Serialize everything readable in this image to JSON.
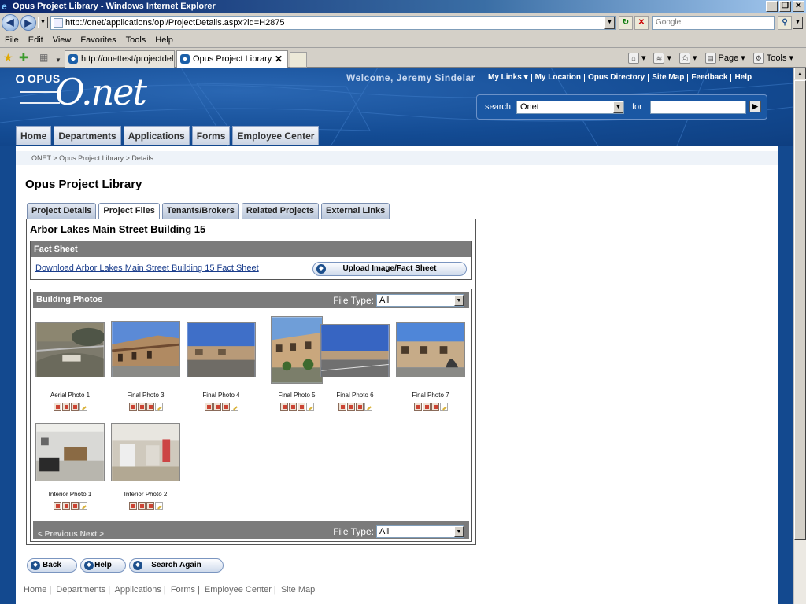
{
  "window": {
    "title": "Opus Project Library - Windows Internet Explorer"
  },
  "browser": {
    "url": "http://onet/applications/opl/ProjectDetails.aspx?id=H2875",
    "search_placeholder": "Google",
    "menu": [
      "File",
      "Edit",
      "View",
      "Favorites",
      "Tools",
      "Help"
    ],
    "tabs": [
      {
        "label": "http://onettest/projectdeliv..."
      },
      {
        "label": "Opus Project Library"
      }
    ],
    "commands": {
      "page": "Page",
      "tools": "Tools"
    }
  },
  "site": {
    "logo_small": "OPUS",
    "logo_large": "O.net",
    "welcome": "Welcome, Jeremy Sindelar",
    "top_links": [
      "My Links ▾",
      "My Location",
      "Opus Directory",
      "Site Map",
      "Feedback",
      "Help"
    ],
    "search": {
      "label": "search",
      "scope": "Onet",
      "for_label": "for"
    },
    "nav_tabs": [
      "Home",
      "Departments",
      "Applications",
      "Forms",
      "Employee Center"
    ]
  },
  "page": {
    "breadcrumb": "ONET > Opus Project Library > Details",
    "title": "Opus Project Library",
    "sub_tabs": [
      "Project Details",
      "Project Files",
      "Tenants/Brokers",
      "Related Projects",
      "External Links"
    ],
    "project_name": "Arbor Lakes Main Street Building 15",
    "fact_sheet": {
      "heading": "Fact Sheet",
      "download_link": "Download Arbor Lakes Main Street Building 15 Fact Sheet",
      "upload_button": "Upload Image/Fact Sheet"
    },
    "photos": {
      "heading": "Building Photos",
      "file_type_label": "File Type:",
      "file_type_value": "All",
      "items": [
        {
          "caption": "Aerial Photo 1"
        },
        {
          "caption": "Final Photo 3"
        },
        {
          "caption": "Final Photo 4"
        },
        {
          "caption": "Final Photo 5"
        },
        {
          "caption": "Final Photo 6"
        },
        {
          "caption": "Final Photo 7"
        },
        {
          "caption": "Interior Photo 1"
        },
        {
          "caption": "Interior Photo 2"
        }
      ],
      "pager": "< Previous Next >"
    },
    "buttons": {
      "back": "Back",
      "help": "Help",
      "search_again": "Search Again"
    },
    "footer_links": [
      "Home",
      "Departments",
      "Applications",
      "Forms",
      "Employee Center",
      "Site Map"
    ]
  }
}
